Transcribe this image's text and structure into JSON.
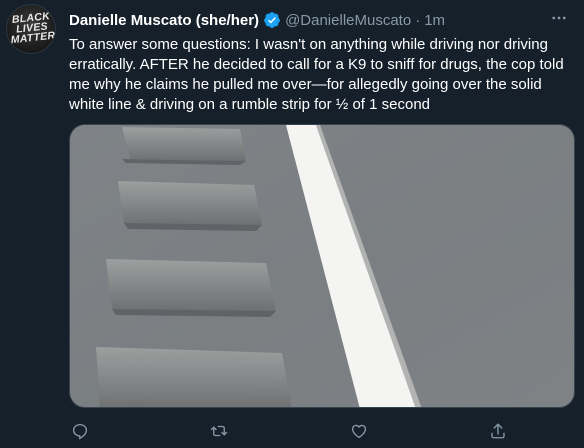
{
  "tweet": {
    "avatar_text": "BLACK LIVES MATTER",
    "author_name": "Danielle Muscato (she/her)",
    "handle": "@DanielleMuscato",
    "separator": "·",
    "timestamp": "1m",
    "more_icon": "more-horizontal-icon",
    "text": "To answer some questions: I wasn't on anything while driving nor driving erratically. AFTER he decided to call for a K9 to sniff for drugs, the cop told me why he claims he pulled me over—for allegedly going over the solid white line & driving on a rumble strip for ½ of 1 second",
    "media": {
      "description_icon": "road-rumble-strip-photo"
    },
    "actions": [
      {
        "name": "reply",
        "icon": "reply-icon"
      },
      {
        "name": "retweet",
        "icon": "retweet-icon"
      },
      {
        "name": "like",
        "icon": "heart-icon"
      },
      {
        "name": "share",
        "icon": "share-icon"
      }
    ]
  },
  "colors": {
    "background": "#15202b",
    "text_primary": "#ffffff",
    "text_secondary": "#8899a6",
    "verified_blue": "#1da1f2",
    "border": "#38444d"
  }
}
